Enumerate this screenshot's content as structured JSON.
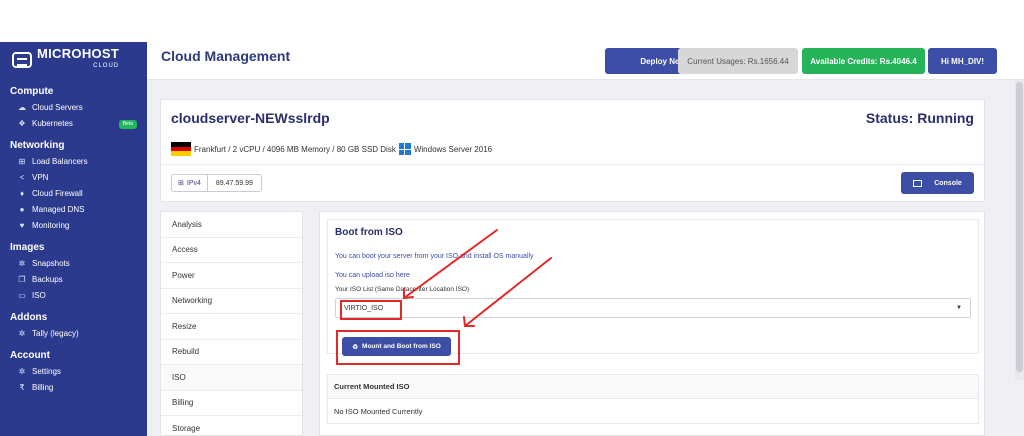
{
  "brand": {
    "name": "MICROHOST",
    "sub": "CLOUD"
  },
  "sidebar": {
    "sections": [
      {
        "title": "Compute",
        "items": [
          {
            "label": "Cloud Servers",
            "icon": "cloud-icon"
          },
          {
            "label": "Kubernetes",
            "icon": "cubes-icon",
            "badge": "Beta"
          }
        ]
      },
      {
        "title": "Networking",
        "items": [
          {
            "label": "Load Balancers",
            "icon": "sitemap-icon"
          },
          {
            "label": "VPN",
            "icon": "share-icon"
          },
          {
            "label": "Cloud Firewall",
            "icon": "fire-icon"
          },
          {
            "label": "Managed DNS",
            "icon": "globe-icon"
          },
          {
            "label": "Monitoring",
            "icon": "heartbeat-icon"
          }
        ]
      },
      {
        "title": "Images",
        "items": [
          {
            "label": "Snapshots",
            "icon": "cogs-icon"
          },
          {
            "label": "Backups",
            "icon": "copy-icon"
          },
          {
            "label": "ISO",
            "icon": "drive-icon"
          }
        ]
      },
      {
        "title": "Addons",
        "items": [
          {
            "label": "Tally (legacy)",
            "icon": "cogs-icon"
          }
        ]
      },
      {
        "title": "Account",
        "items": [
          {
            "label": "Settings",
            "icon": "cogs-icon"
          },
          {
            "label": "Billing",
            "icon": "rupee-icon"
          }
        ]
      }
    ]
  },
  "header": {
    "title": "Cloud Management",
    "deploy_label": "Deploy New",
    "usage_label": "Current Usages: Rs.1656.44",
    "credits_label": "Available Credits: Rs.4046.4",
    "user_label": "Hi MH_DIV!"
  },
  "server": {
    "name": "cloudserver-NEWsslrdp",
    "status": "Status: Running",
    "specs": "Frankfurt / 2 vCPU / 4096 MB Memory / 80 GB SSD Disk",
    "os": "Windows Server 2016",
    "ip_type": "IPv4",
    "ip": "89.47.59.99",
    "console_label": "Console"
  },
  "tabs": [
    "Analysis",
    "Access",
    "Power",
    "Networking",
    "Resize",
    "Rebuild",
    "ISO",
    "Billing",
    "Storage"
  ],
  "iso": {
    "title": "Boot from ISO",
    "line1": "You can boot your server from your ISO and install OS manually",
    "line2_prefix": "You can upload iso ",
    "line2_link": "here",
    "list_label": "Your ISO List (Same Datacenter Location ISO)",
    "selected": "VIRTIO_ISO",
    "mount_label": "Mount and Boot from ISO",
    "mounted_title": "Current Mounted ISO",
    "mounted_value": "No ISO Mounted Currently"
  },
  "colors": {
    "sidebar": "#2c3a8e",
    "primary": "#3d4ea6",
    "success": "#27b35a",
    "highlight": "#e02a2a"
  }
}
